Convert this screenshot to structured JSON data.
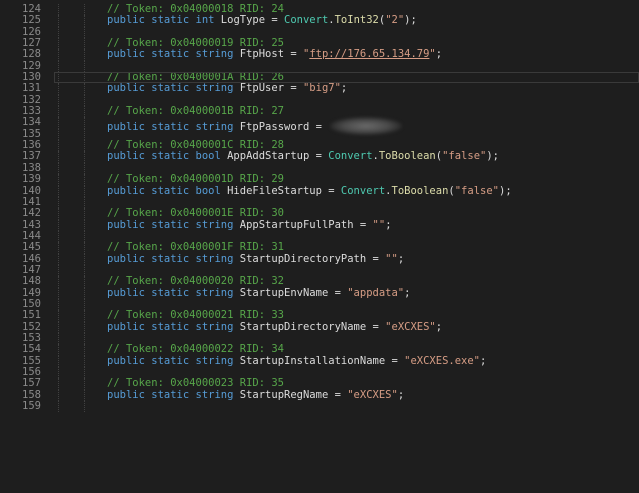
{
  "editor": {
    "current_line": 130,
    "colors": {
      "background": "#1e1e1e",
      "line_number": "#8a8a8a",
      "comment": "#57a64a",
      "keyword": "#569cd6",
      "type": "#4ec9b0",
      "method": "#dcdcaa",
      "string": "#d69d85"
    },
    "lines": [
      {
        "n": "124",
        "kind": "comment",
        "text": "// Token: 0x04000018 RID: 24"
      },
      {
        "n": "125",
        "kind": "convert",
        "decl": "public static int LogType = ",
        "type": "Convert",
        "method": "ToInt32",
        "arg": "\"2\"",
        "end": ");"
      },
      {
        "n": "126",
        "kind": "blank"
      },
      {
        "n": "127",
        "kind": "comment",
        "text": "// Token: 0x04000019 RID: 25"
      },
      {
        "n": "128",
        "kind": "link",
        "decl": "public static string FtpHost = ",
        "q1": "\"",
        "link": "ftp://176.65.134.79",
        "q2": "\"",
        "end": ";"
      },
      {
        "n": "129",
        "kind": "blank"
      },
      {
        "n": "130",
        "kind": "comment",
        "text": "// Token: 0x0400001A RID: 26"
      },
      {
        "n": "131",
        "kind": "string",
        "decl": "public static string FtpUser = ",
        "value": "\"big7\"",
        "end": ";"
      },
      {
        "n": "132",
        "kind": "blank"
      },
      {
        "n": "133",
        "kind": "comment",
        "text": "// Token: 0x0400001B RID: 27"
      },
      {
        "n": "134",
        "kind": "redacted",
        "decl": "public static string FtpPassword = "
      },
      {
        "n": "135",
        "kind": "blank"
      },
      {
        "n": "136",
        "kind": "comment",
        "text": "// Token: 0x0400001C RID: 28"
      },
      {
        "n": "137",
        "kind": "convert",
        "decl": "public static bool AppAddStartup = ",
        "type": "Convert",
        "method": "ToBoolean",
        "arg": "\"false\"",
        "end": ");"
      },
      {
        "n": "138",
        "kind": "blank"
      },
      {
        "n": "139",
        "kind": "comment",
        "text": "// Token: 0x0400001D RID: 29"
      },
      {
        "n": "140",
        "kind": "convert",
        "decl": "public static bool HideFileStartup = ",
        "type": "Convert",
        "method": "ToBoolean",
        "arg": "\"false\"",
        "end": ");"
      },
      {
        "n": "141",
        "kind": "blank"
      },
      {
        "n": "142",
        "kind": "comment",
        "text": "// Token: 0x0400001E RID: 30"
      },
      {
        "n": "143",
        "kind": "string",
        "decl": "public static string AppStartupFullPath = ",
        "value": "\"\"",
        "end": ";"
      },
      {
        "n": "144",
        "kind": "blank"
      },
      {
        "n": "145",
        "kind": "comment",
        "text": "// Token: 0x0400001F RID: 31"
      },
      {
        "n": "146",
        "kind": "string",
        "decl": "public static string StartupDirectoryPath = ",
        "value": "\"\"",
        "end": ";"
      },
      {
        "n": "147",
        "kind": "blank"
      },
      {
        "n": "148",
        "kind": "comment",
        "text": "// Token: 0x04000020 RID: 32"
      },
      {
        "n": "149",
        "kind": "string",
        "decl": "public static string StartupEnvName = ",
        "value": "\"appdata\"",
        "end": ";"
      },
      {
        "n": "150",
        "kind": "blank"
      },
      {
        "n": "151",
        "kind": "comment",
        "text": "// Token: 0x04000021 RID: 33"
      },
      {
        "n": "152",
        "kind": "string",
        "decl": "public static string StartupDirectoryName = ",
        "value": "\"eXCXES\"",
        "end": ";"
      },
      {
        "n": "153",
        "kind": "blank"
      },
      {
        "n": "154",
        "kind": "comment",
        "text": "// Token: 0x04000022 RID: 34"
      },
      {
        "n": "155",
        "kind": "string",
        "decl": "public static string StartupInstallationName = ",
        "value": "\"eXCXES.exe\"",
        "end": ";"
      },
      {
        "n": "156",
        "kind": "blank"
      },
      {
        "n": "157",
        "kind": "comment",
        "text": "// Token: 0x04000023 RID: 35"
      },
      {
        "n": "158",
        "kind": "string",
        "decl": "public static string StartupRegName = ",
        "value": "\"eXCXES\"",
        "end": ";"
      },
      {
        "n": "159",
        "kind": "blank"
      }
    ]
  }
}
